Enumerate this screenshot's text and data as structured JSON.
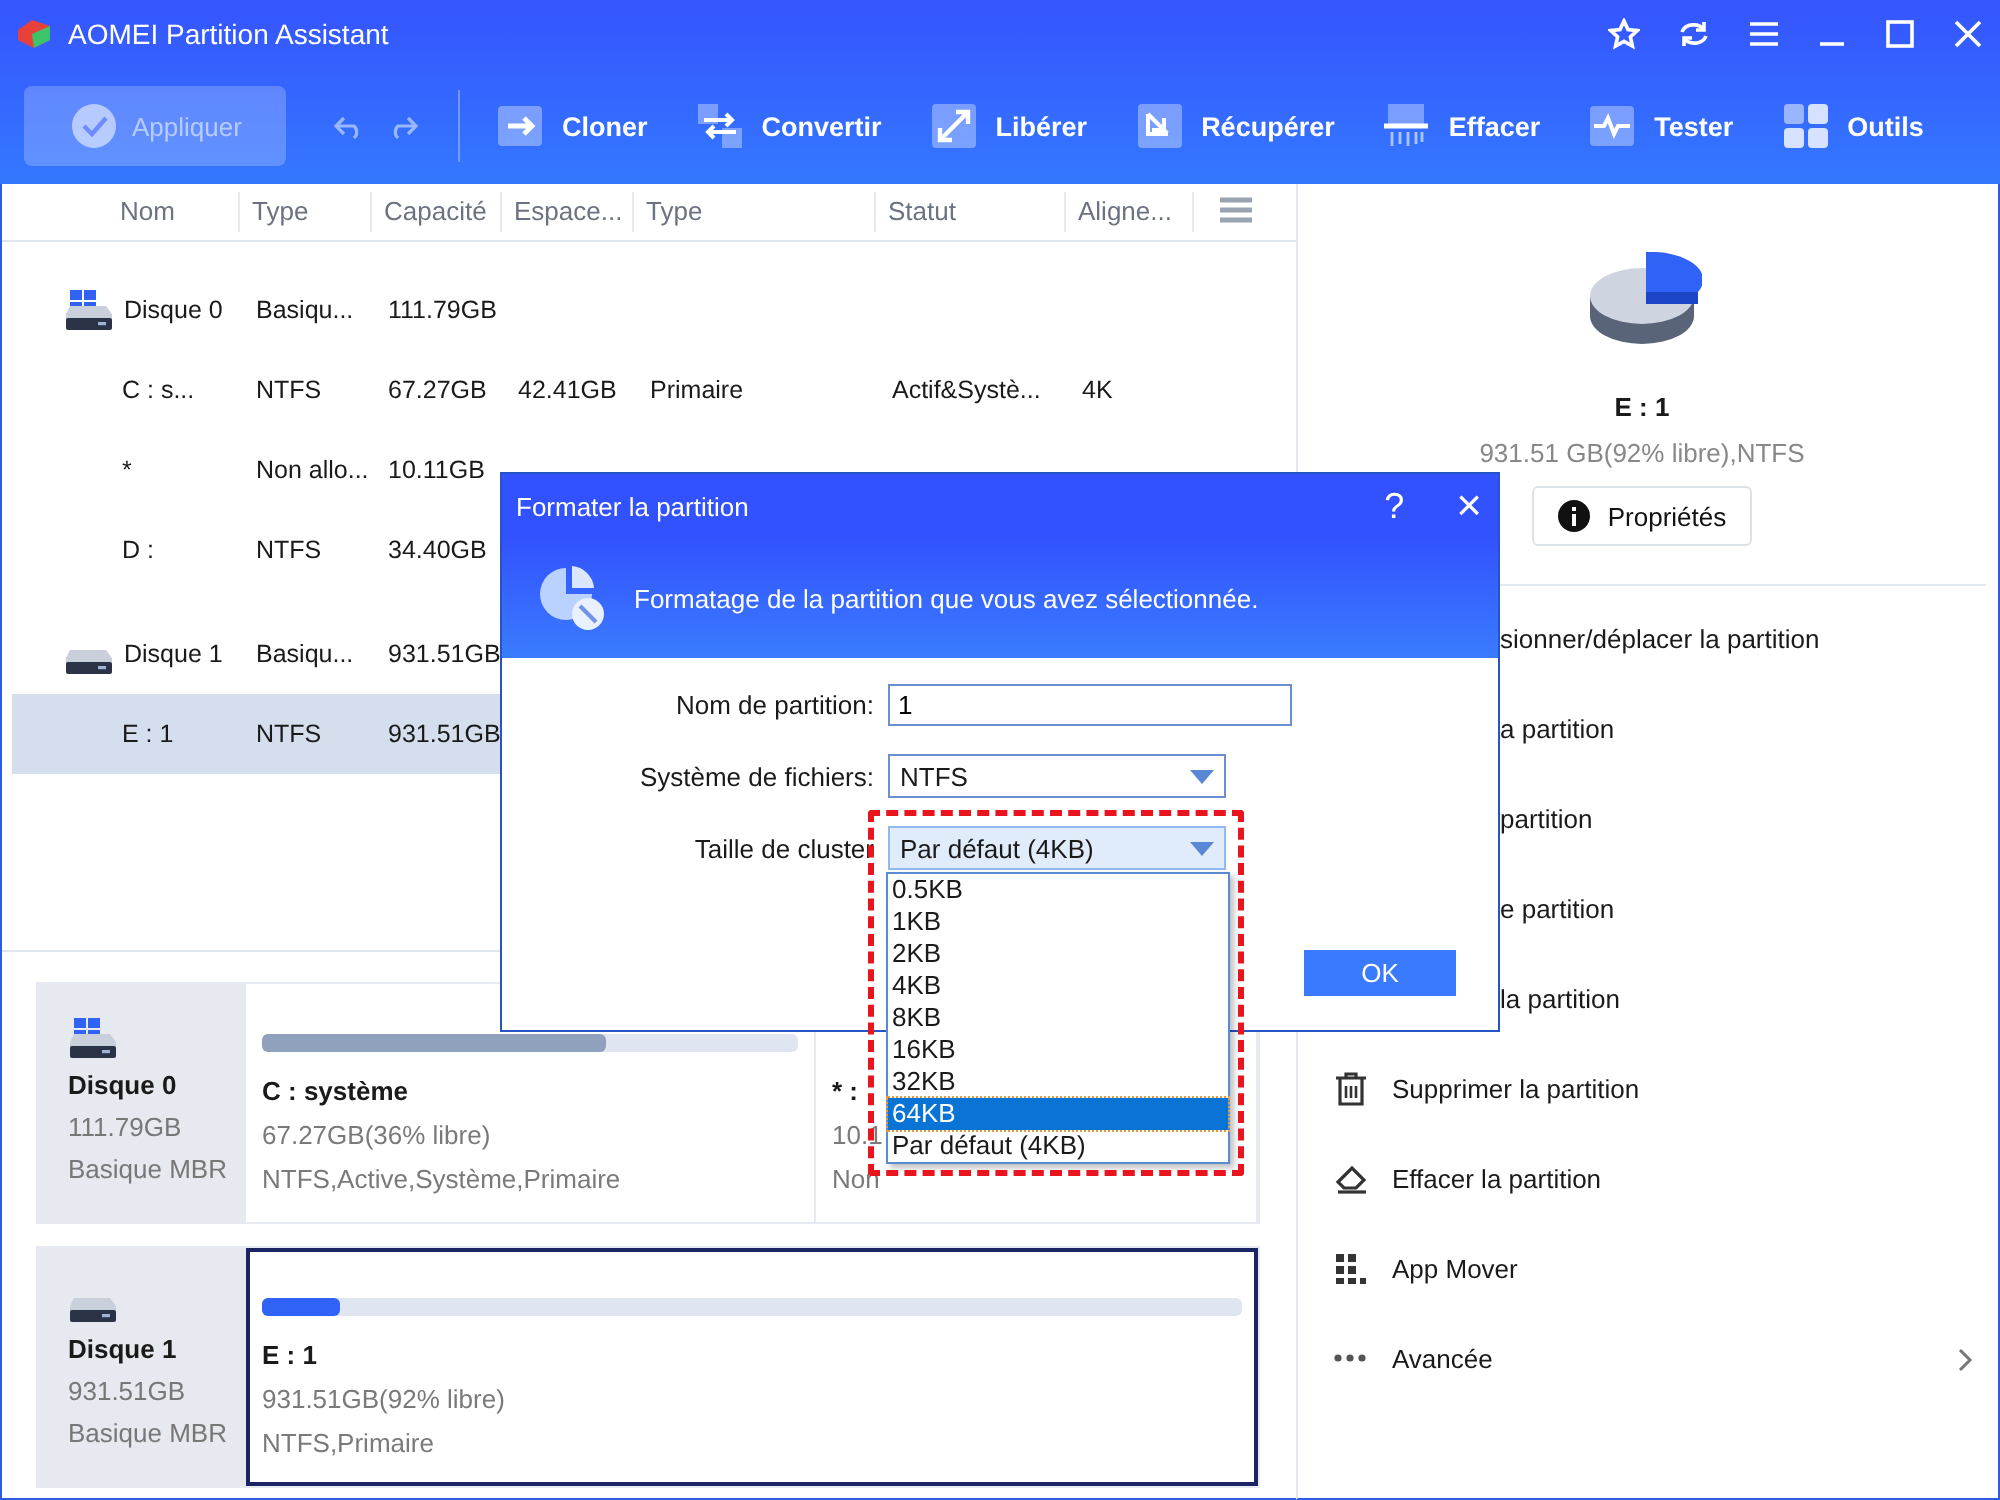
{
  "window": {
    "title": "AOMEI Partition Assistant"
  },
  "toolbar": {
    "apply": {
      "label": "Appliquer",
      "disabled": true
    },
    "tools": [
      {
        "kind": "clone",
        "label": "Cloner"
      },
      {
        "kind": "convert",
        "label": "Convertir"
      },
      {
        "kind": "free",
        "label": "Libérer"
      },
      {
        "kind": "recover",
        "label": "Récupérer"
      },
      {
        "kind": "wipe",
        "label": "Effacer"
      },
      {
        "kind": "test",
        "label": "Tester"
      },
      {
        "kind": "tools",
        "label": "Outils"
      }
    ]
  },
  "table": {
    "columns": [
      "Nom",
      "Type",
      "Capacité",
      "Espace...",
      "Type",
      "Statut",
      "Aligne..."
    ],
    "rows": [
      {
        "kind": "system-disk",
        "selected": false,
        "cells": [
          "Disque 0",
          "Basiqu...",
          "111.79GB"
        ]
      },
      {
        "kind": "partition",
        "selected": false,
        "cells": [
          "C : s...",
          "NTFS",
          "67.27GB",
          "42.41GB",
          "Primaire",
          "Actif&Systè...",
          "4K"
        ]
      },
      {
        "kind": "partition",
        "selected": false,
        "cells": [
          "*",
          "Non allo...",
          "10.11GB"
        ]
      },
      {
        "kind": "partition",
        "selected": false,
        "cells": [
          "D :",
          "NTFS",
          "34.40GB"
        ]
      },
      {
        "kind": "disk",
        "selected": false,
        "cells": [
          "Disque 1",
          "Basiqu...",
          "931.51GB"
        ]
      },
      {
        "kind": "partition",
        "selected": true,
        "cells": [
          "E : 1",
          "NTFS",
          "931.51GB"
        ]
      }
    ]
  },
  "disk_map": [
    {
      "kind": "system-disk",
      "name": "Disque 0",
      "size": "111.79GB",
      "type": "Basique MBR",
      "partitions": [
        {
          "name": "C : système",
          "size": "67.27GB(36% libre)",
          "info": "NTFS,Active,Système,Primaire",
          "selected": false,
          "level": 0.64
        },
        {
          "name": "* :",
          "size": "10.1",
          "info": "Non",
          "selected": false
        }
      ]
    },
    {
      "kind": "disk",
      "name": "Disque 1",
      "size": "931.51GB",
      "type": "Basique MBR",
      "partitions": [
        {
          "name": "E : 1",
          "size": "931.51GB(92% libre)",
          "info": "NTFS,Primaire",
          "selected": true,
          "level": 0.08
        }
      ]
    }
  ],
  "details": {
    "name": "E : 1",
    "summary": "931.51 GB(92% libre),NTFS",
    "button": "Propriétés",
    "operations": [
      {
        "kind": "covered",
        "label": "sionner/déplacer la partition"
      },
      {
        "kind": "covered",
        "label": "a partition"
      },
      {
        "kind": "covered",
        "label": "partition"
      },
      {
        "kind": "covered",
        "label": "e partition"
      },
      {
        "kind": "covered",
        "label": "la partition"
      },
      {
        "kind": "delete",
        "label": "Supprimer la partition"
      },
      {
        "kind": "wipe",
        "label": "Effacer la partition"
      },
      {
        "kind": "apps",
        "label": "App Mover"
      },
      {
        "kind": "more",
        "label": "Avancée"
      }
    ]
  },
  "dialog": {
    "title": "Formater la partition",
    "help": "?",
    "close": "×",
    "message": "Formatage de la partition que vous avez sélectionnée.",
    "fields": [
      {
        "kind": "text",
        "label": "Nom de partition:",
        "value": "1"
      },
      {
        "kind": "select",
        "label": "Système de fichiers:",
        "value": "NTFS",
        "open": false
      },
      {
        "kind": "select",
        "label": "Taille de cluster",
        "value": "Par défaut (4KB)",
        "open": true,
        "options": [
          {
            "label": "0.5KB",
            "highlighted": false
          },
          {
            "label": "1KB",
            "highlighted": false
          },
          {
            "label": "2KB",
            "highlighted": false
          },
          {
            "label": "4KB",
            "highlighted": false
          },
          {
            "label": "8KB",
            "highlighted": false
          },
          {
            "label": "16KB",
            "highlighted": false
          },
          {
            "label": "32KB",
            "highlighted": false
          },
          {
            "label": "64KB",
            "highlighted": true
          },
          {
            "label": "Par défaut (4KB)",
            "highlighted": false
          }
        ]
      }
    ],
    "ok": "OK"
  }
}
